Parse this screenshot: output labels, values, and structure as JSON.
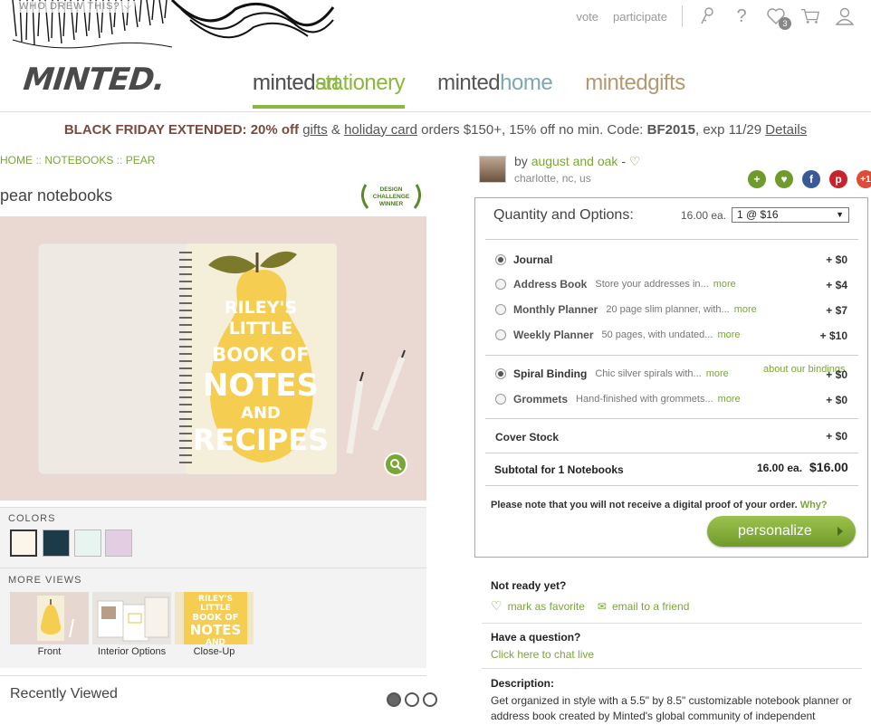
{
  "header": {
    "who_drew": "WHO DREW THIS?",
    "logo": "MINTED.",
    "links": {
      "vote": "vote",
      "participate": "participate"
    },
    "cart_badge": "3",
    "nav": [
      {
        "brand": "minted",
        "section": "stationery"
      },
      {
        "brand": "minted",
        "section": "art"
      },
      {
        "brand": "minted",
        "section": "home"
      },
      {
        "brand": "minted",
        "section": "gifts"
      }
    ]
  },
  "promo": {
    "bold": "BLACK FRIDAY EXTENDED:",
    "pct": "20% off",
    "gifts": "gifts",
    "amp": "&",
    "holiday": "holiday card",
    "rest": "orders $150+, 15% off no min. Code:",
    "code": "BF2015",
    "exp": ", exp 11/29",
    "details": "Details"
  },
  "breadcrumb": {
    "home": "HOME",
    "notebooks": "NOTEBOOKS",
    "pear": "PEAR",
    "sep": "::"
  },
  "product": {
    "title": "pear notebooks",
    "badge": [
      "DESIGN",
      "CHALLENGE",
      "WINNER"
    ],
    "cover_lines": [
      "RILEY'S",
      "LITTLE",
      "BOOK OF",
      "NOTES",
      "AND",
      "RECIPES"
    ]
  },
  "colors": {
    "label": "COLORS",
    "swatches": [
      "#fbf6e9",
      "#1d3a48",
      "#e7f4f0",
      "#e3cde2"
    ]
  },
  "more_views": {
    "label": "MORE VIEWS",
    "items": [
      "Front",
      "Interior Options",
      "Close-Up"
    ]
  },
  "recent": {
    "title": "Recently Viewed"
  },
  "designer": {
    "by": "by",
    "name": "august and oak",
    "dash": "-",
    "location": "charlotte, nc, us"
  },
  "options": {
    "title": "Quantity and Options:",
    "each": "16.00 ea.",
    "qty": "1 @ $16",
    "rows": [
      {
        "name": "Journal",
        "desc": "",
        "more": "",
        "price": "+ $0"
      },
      {
        "name": "Address Book",
        "desc": "Store your addresses in...",
        "more": "more",
        "price": "+ $4"
      },
      {
        "name": "Monthly Planner",
        "desc": "20 page slim planner, with...",
        "more": "more",
        "price": "+ $7"
      },
      {
        "name": "Weekly Planner",
        "desc": "50 pages, with undated...",
        "more": "more",
        "price": "+ $10"
      },
      {
        "name": "Spiral Binding",
        "desc": "Chic silver spirals with...",
        "more": "more",
        "price": "+ $0"
      },
      {
        "name": "Grommets",
        "desc": "Hand-finished with grommets...",
        "more": "more",
        "price": "+ $0"
      }
    ],
    "about_bindings": "about our bindings",
    "cover_stock": "Cover Stock",
    "cover_price": "+ $0",
    "subtotal_label": "Subtotal for 1 Notebooks",
    "subtotal_each": "16.00 ea.",
    "subtotal_price": "$16.00",
    "note": "Please note that you will not receive a digital proof of your order.",
    "why": "Why?",
    "personalize": "personalize"
  },
  "aside": {
    "not_ready": "Not ready yet?",
    "favorite": "mark as favorite",
    "email": "email to a friend",
    "question": "Have a question?",
    "chat": "Click here to chat live",
    "desc_label": "Description:",
    "desc": "Get organized in style with a 5.5\" by 8.5\" customizable notebook planner or address book created by Minted's global community of independent"
  }
}
